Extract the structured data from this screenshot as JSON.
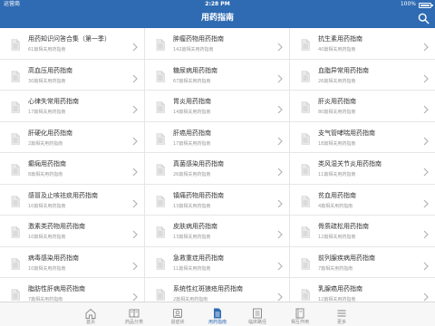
{
  "status_bar": {
    "carrier": "运营商",
    "time": "2:28 PM",
    "battery": "100%"
  },
  "nav": {
    "title": "用药指南"
  },
  "items": [
    {
      "name": "用药知识问答合集（第一季）",
      "count": "61篇相关用药指南"
    },
    {
      "name": "肿瘤药物用药指南",
      "count": "142篇相关用药指南"
    },
    {
      "name": "抗生素用药指南",
      "count": "40篇相关用药指南"
    },
    {
      "name": "高血压用药指南",
      "count": "30篇相关用药指南"
    },
    {
      "name": "糖尿病用药指南",
      "count": "67篇相关用药指南"
    },
    {
      "name": "血脂异常用药指南",
      "count": "26篇相关用药指南"
    },
    {
      "name": "心律失常用药指南",
      "count": "17篇相关用药指南"
    },
    {
      "name": "胃炎用药指南",
      "count": "14篇相关用药指南"
    },
    {
      "name": "肝炎用药指南",
      "count": "80篇相关用药指南"
    },
    {
      "name": "肝硬化用药指南",
      "count": "2篇相关用药指南"
    },
    {
      "name": "肝癌用药指南",
      "count": "17篇相关用药指南"
    },
    {
      "name": "支气管哮喘用药指南",
      "count": "18篇相关用药指南"
    },
    {
      "name": "癫痫用药指南",
      "count": "8篇相关用药指南"
    },
    {
      "name": "真菌感染用药指南",
      "count": "26篇相关用药指南"
    },
    {
      "name": "类风湿关节炎用药指南",
      "count": "11篇相关用药指南"
    },
    {
      "name": "感冒及止咳祛痰用药指南",
      "count": "10篇相关用药指南"
    },
    {
      "name": "镇痛药物用药指南",
      "count": "13篇相关用药指南"
    },
    {
      "name": "贫血用药指南",
      "count": "4篇相关用药指南"
    },
    {
      "name": "激素类药物用药指南",
      "count": "10篇相关用药指南"
    },
    {
      "name": "皮肤病用药指南",
      "count": "13篇相关用药指南"
    },
    {
      "name": "骨质疏松用药指南",
      "count": "12篇相关用药指南"
    },
    {
      "name": "病毒感染用药指南",
      "count": "10篇相关用药指南"
    },
    {
      "name": "急救重症用药指南",
      "count": "11篇相关用药指南"
    },
    {
      "name": "前列腺疾病用药指南",
      "count": "7篇相关用药指南"
    },
    {
      "name": "脂肪性肝病用药指南",
      "count": "7篇相关用药指南"
    },
    {
      "name": "系统性红斑狼疮用药指南",
      "count": "2篇相关用药指南"
    },
    {
      "name": "乳腺癌用药指南",
      "count": "12篇相关用药指南"
    }
  ],
  "tabs": [
    {
      "label": "首页",
      "icon": "home-icon"
    },
    {
      "label": "药品分类",
      "icon": "category-icon"
    },
    {
      "label": "退症状",
      "icon": "user-icon"
    },
    {
      "label": "用药指南",
      "icon": "document-icon",
      "active": true
    },
    {
      "label": "临床路径",
      "icon": "list-icon"
    },
    {
      "label": "相互作用",
      "icon": "book-icon"
    },
    {
      "label": "更多",
      "icon": "menu-icon"
    }
  ],
  "colors": {
    "primary": "#2f6bb3",
    "background": "#ffffff",
    "divider": "#e6e6e6"
  }
}
